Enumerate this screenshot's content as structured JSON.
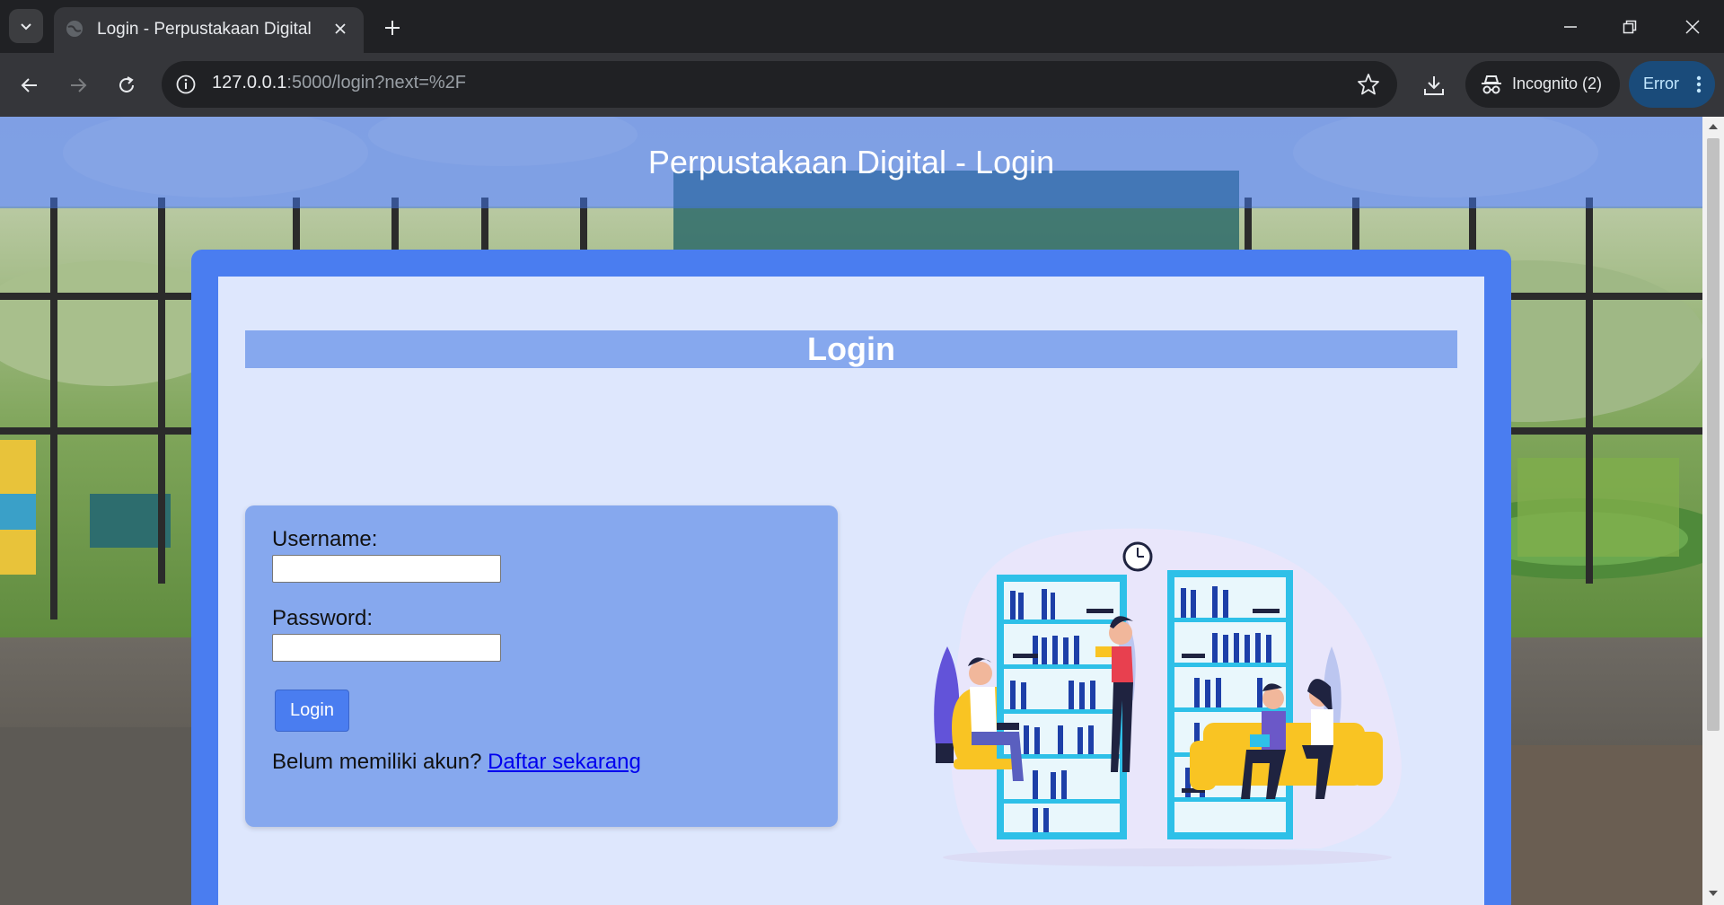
{
  "browser": {
    "tab_title": "Login - Perpustakaan Digital",
    "url_host": "127.0.0.1",
    "url_rest": ":5000/login?next=%2F",
    "incognito_label": "Incognito (2)",
    "error_label": "Error",
    "icons": [
      "tab-search-chevron-icon",
      "globe-icon",
      "close-icon",
      "plus-icon",
      "minimize-icon",
      "restore-icon",
      "window-close-icon",
      "back-arrow-icon",
      "forward-arrow-icon",
      "reload-icon",
      "site-info-icon",
      "star-icon",
      "download-icon",
      "incognito-icon",
      "kebab-menu-icon"
    ]
  },
  "page": {
    "header_title": "Perpustakaan Digital - Login",
    "login_heading": "Login",
    "form": {
      "username_label": "Username:",
      "username_value": "",
      "password_label": "Password:",
      "password_value": "",
      "submit_label": "Login",
      "register_prompt": "Belum memiliki akun?",
      "register_link": "Daftar sekarang"
    }
  },
  "colors": {
    "accent_blue": "#4a7df0",
    "panel_blue": "#86a8ee",
    "link_blue": "#0000ee"
  }
}
